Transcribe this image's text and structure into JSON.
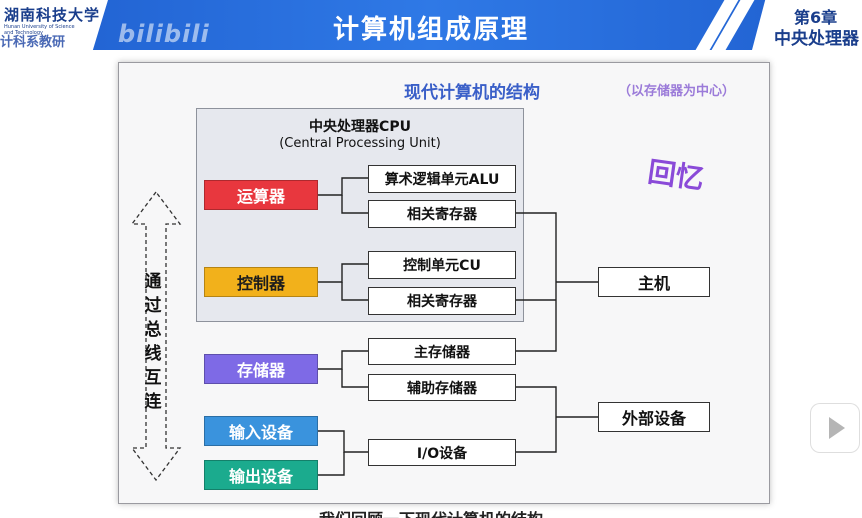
{
  "header": {
    "logo_text": "湖南科技大学",
    "logo_subtext": "Hunan University of Science and Technology",
    "logo_dept": "计科系教研",
    "watermark": "bilibili",
    "title": "计算机组成原理",
    "chapter_number": "第6章",
    "chapter_name": "中央处理器"
  },
  "diagram": {
    "title": "现代计算机的结构",
    "subtitle": "（以存储器为中心）",
    "stamp": "回忆",
    "cpu_title": "中央处理器CPU",
    "cpu_subtitle": "(Central Processing Unit)",
    "bus_label": "通过总线互连",
    "components": {
      "alu": "运算器",
      "control": "控制器",
      "memory": "存储器",
      "input": "输入设备",
      "output": "输出设备"
    },
    "parts": {
      "alu_unit": "算术逻辑单元ALU",
      "alu_registers": "相关寄存器",
      "cu_unit": "控制单元CU",
      "cu_registers": "相关寄存器",
      "main_memory": "主存储器",
      "aux_memory": "辅助存储器",
      "io_devices": "I/O设备"
    },
    "groups": {
      "host": "主机",
      "peripherals": "外部设备"
    },
    "colors": {
      "alu": "#e8373e",
      "control": "#f2b11b",
      "memory": "#7e6ae6",
      "input": "#3a93dd",
      "output": "#1bab8e"
    }
  },
  "caption": "我们回顾一下现代计算机的结构"
}
